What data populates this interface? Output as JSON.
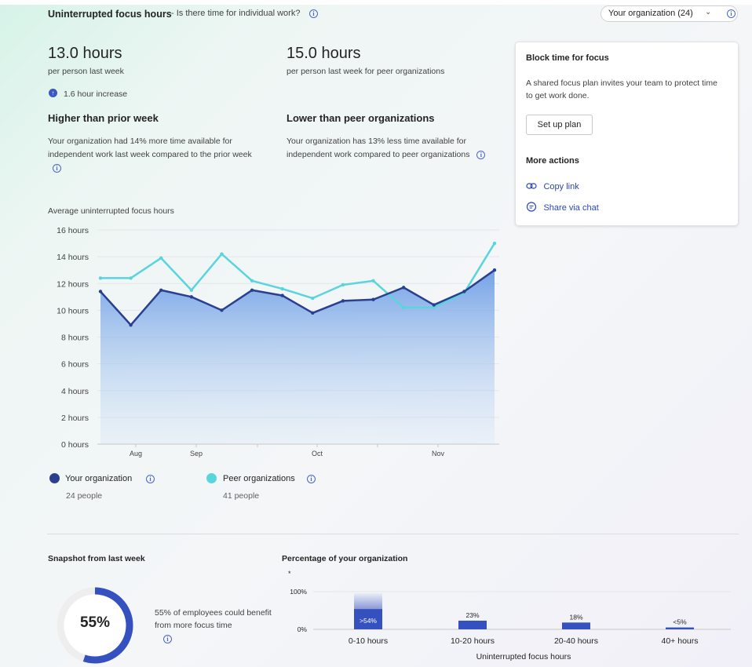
{
  "header": {
    "title": "Uninterrupted focus hours",
    "subtitle": "- Is there time for individual work?",
    "org_dropdown": "Your organization (24)"
  },
  "metrics": {
    "own": {
      "value": "13.0 hours",
      "caption": "per person last week",
      "change": "1.6 hour increase",
      "heading": "Higher than prior week",
      "description": "Your organization had 14% more time available for independent work last week compared to the prior week"
    },
    "peer": {
      "value": "15.0 hours",
      "caption": "per person last week for peer organizations",
      "heading": "Lower than peer organizations",
      "description": "Your organization has 13% less time available for independent work compared to peer organizations"
    }
  },
  "card": {
    "title": "Block time for focus",
    "body": "A shared focus plan invites your team to protect time to get work done.",
    "button": "Set up plan",
    "more_actions": "More actions",
    "copy_link": "Copy link",
    "share_chat": "Share via chat",
    "icons": [
      "link-icon",
      "chat-icon"
    ]
  },
  "chart_data": [
    {
      "type": "area",
      "title": "Average uninterrupted focus hours",
      "ylim": [
        0,
        16
      ],
      "yticks": [
        "16 hours",
        "14 hours",
        "12 hours",
        "10 hours",
        "8 hours",
        "6 hours",
        "4 hours",
        "2 hours",
        "0 hours"
      ],
      "x_tick_labels": [
        "Aug",
        "Sep",
        "Oct",
        "Nov"
      ],
      "grid": true,
      "series": [
        {
          "name": "Your organization",
          "color": "#2b3f8f",
          "values": [
            11.4,
            8.9,
            11.5,
            11.0,
            10.0,
            11.5,
            11.1,
            9.8,
            10.7,
            10.8,
            11.7,
            10.4,
            11.4,
            13.0
          ]
        },
        {
          "name": "Peer organizations",
          "color": "#5ad4dd",
          "values": [
            12.4,
            12.4,
            13.9,
            11.5,
            14.2,
            12.2,
            11.6,
            10.9,
            11.9,
            12.2,
            10.2,
            10.2,
            11.3,
            15.0
          ]
        }
      ],
      "legend": [
        {
          "name": "Your organization",
          "people": "24 people",
          "color": "#2b3f8f"
        },
        {
          "name": "Peer organizations",
          "people": "41 people",
          "color": "#5ad4dd"
        }
      ]
    },
    {
      "type": "bar",
      "title": "Percentage of your organization",
      "note": "*",
      "xlabel": "Uninterrupted focus hours",
      "yticks": [
        "100%",
        "0%"
      ],
      "categories": [
        "0-10 hours",
        "10-20 hours",
        "20-40 hours",
        "40+ hours"
      ],
      "values": [
        54,
        23,
        18,
        5
      ],
      "labels": [
        ">54%",
        "23%",
        "18%",
        "<5%"
      ],
      "color": "#3550bf"
    }
  ],
  "snapshot": {
    "title": "Snapshot from last week",
    "percent": "55%",
    "percent_value": 55,
    "description": "55% of employees could benefit from more focus time"
  }
}
